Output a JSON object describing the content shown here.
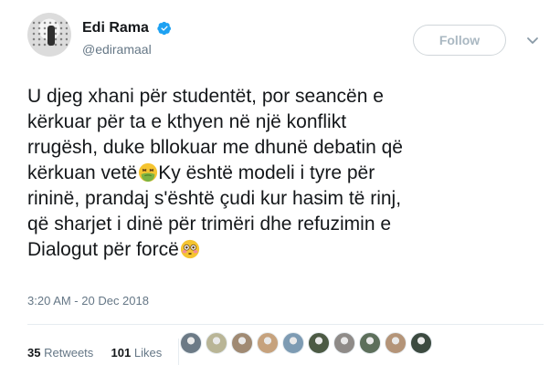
{
  "author": {
    "name": "Edi Rama",
    "handle": "@ediramaal",
    "verified_icon": "verified-badge-icon"
  },
  "follow_label": "Follow",
  "tweet": {
    "line1": "U djeg xhani për studentët, por seancën e",
    "line2": "kërkuar për ta e kthyen në një konflikt",
    "line3": "rrugësh, duke bllokuar me dhunë debatin që",
    "line4a": "kërkuan vetë",
    "line4b": "Ky është modeli i tyre për",
    "line5": "rininë, prandaj s'është çudi kur hasim të rinj,",
    "line6": "që sharjet i dinë për trimëri dhe refuzimin e",
    "line7": "Dialogut për forcë",
    "emoji1": "nauseated-face-icon",
    "emoji2": "flushed-face-icon"
  },
  "timestamp": "3:20 AM - 20 Dec 2018",
  "stats": {
    "retweets_count": "35",
    "retweets_label": "Retweets",
    "likes_count": "101",
    "likes_label": "Likes"
  },
  "colors": {
    "name": "#14171a",
    "muted": "#657786",
    "verified": "#1da1f2",
    "follow_border": "#d0d6da"
  },
  "likers": [
    {
      "color": "#6c7a86"
    },
    {
      "color": "#b9b596"
    },
    {
      "color": "#a08a73"
    },
    {
      "color": "#c6a27d"
    },
    {
      "color": "#7d9bb3"
    },
    {
      "color": "#4c5a44"
    },
    {
      "color": "#8f8b88"
    },
    {
      "color": "#5d6f5b"
    },
    {
      "color": "#b49478"
    },
    {
      "color": "#3c4a40"
    }
  ]
}
